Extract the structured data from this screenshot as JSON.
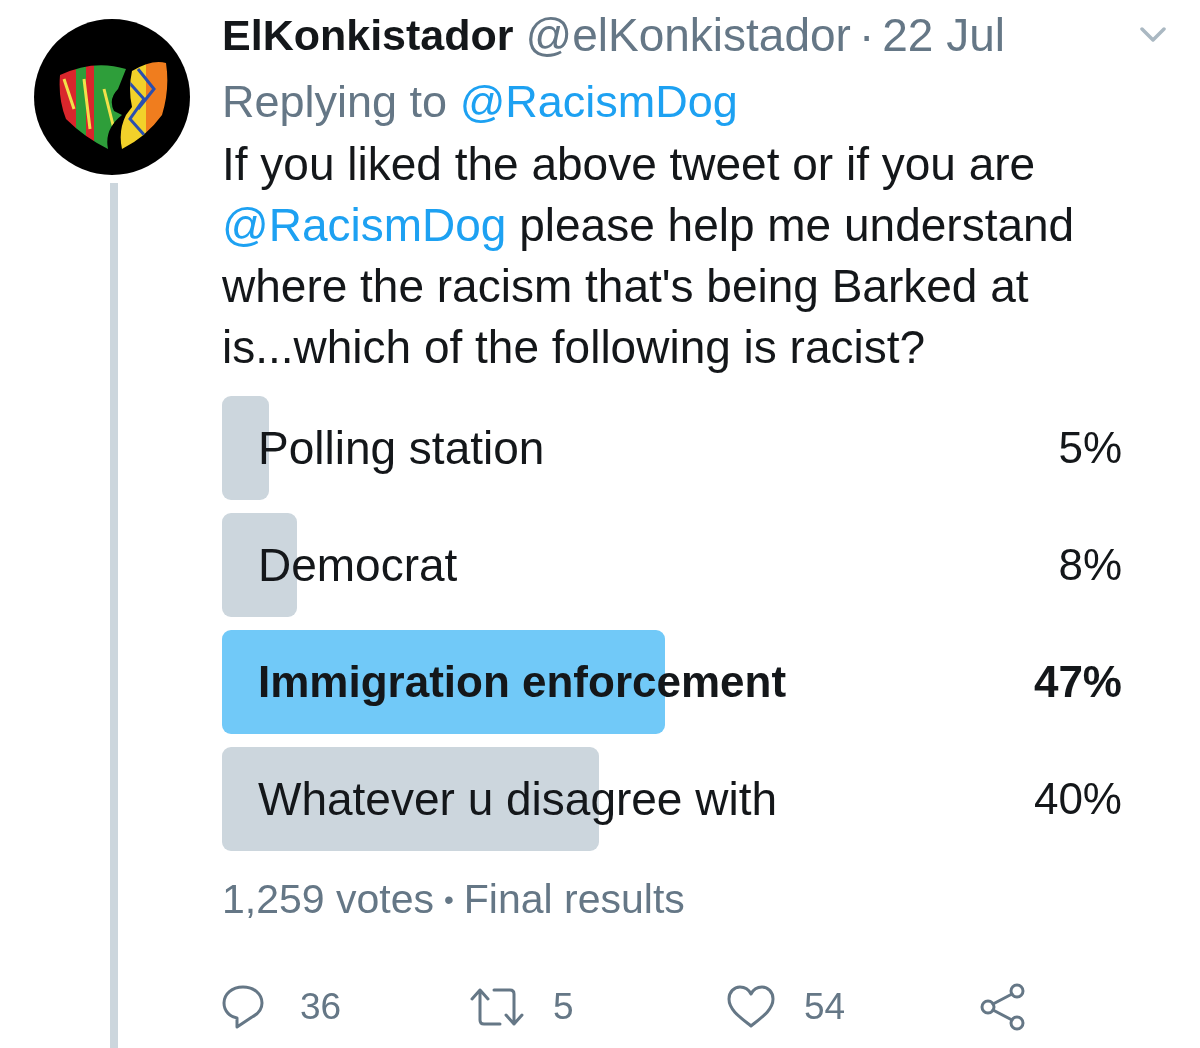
{
  "tweet": {
    "author": {
      "display_name": "ElKonkistador",
      "handle": "@elKonkistador"
    },
    "separator": "·",
    "date": "22 Jul",
    "replying_to": {
      "label": "Replying to",
      "mention": "@RacismDog"
    },
    "body": [
      {
        "kind": "text",
        "text": "If you liked the above tweet or if you are "
      },
      {
        "kind": "mention",
        "text": "@RacismDog"
      },
      {
        "kind": "text",
        "text": " please help me understand where the racism that's being Barked at is...which of the following is racist?"
      }
    ]
  },
  "poll": {
    "options": [
      {
        "label": "Polling station",
        "percent": "5%",
        "level": 0.05,
        "winner": false
      },
      {
        "label": "Democrat",
        "percent": "8%",
        "level": 0.08,
        "winner": false
      },
      {
        "label": "Immigration enforcement",
        "percent": "47%",
        "level": 0.47,
        "winner": true
      },
      {
        "label": "Whatever u disagree with",
        "percent": "40%",
        "level": 0.4,
        "winner": false
      }
    ],
    "vote_count": "1,259 votes",
    "separator": "•",
    "status": "Final results"
  },
  "actions": [
    {
      "kind": "reply",
      "count": "36"
    },
    {
      "kind": "retweet",
      "count": "5"
    },
    {
      "kind": "like",
      "count": "54"
    },
    {
      "kind": "share"
    }
  ]
}
